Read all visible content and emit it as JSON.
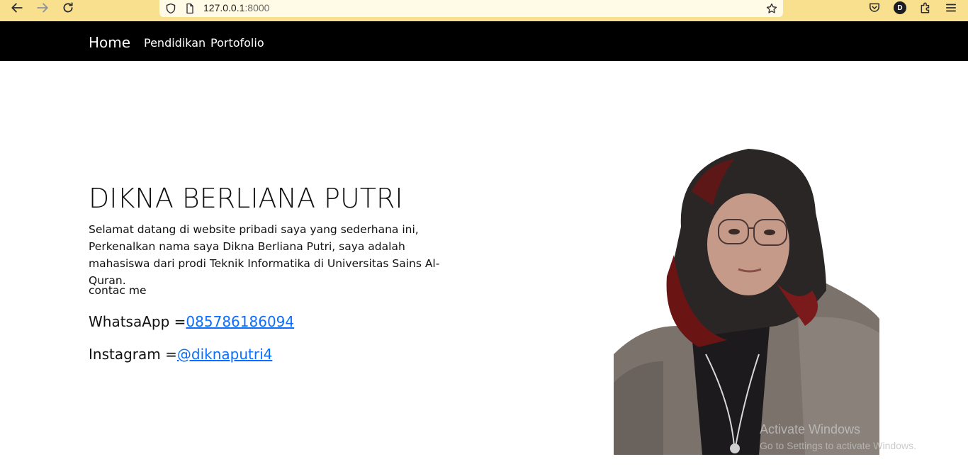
{
  "browser": {
    "url_host": "127.0.0.1",
    "url_port": ":8000",
    "profile_initial": "D",
    "icons": [
      "back-arrow-icon",
      "forward-arrow-icon",
      "reload-icon",
      "shield-icon",
      "page-icon",
      "star-icon",
      "pocket-icon",
      "extensions-icon",
      "menu-icon"
    ]
  },
  "nav": {
    "brand": "Home",
    "links": [
      "Pendidikan",
      "Portofolio"
    ]
  },
  "hero": {
    "title": "DIKNA BERLIANA PUTRI",
    "intro": "Selamat datang di website pribadi saya yang sederhana ini, Perkenalkan nama saya Dikna Berliana Putri, saya adalah mahasiswa dari prodi Teknik Informatika di Universitas Sains Al-Quran.",
    "contact_label": "contac me",
    "whatsapp_label": "WhatsaApp =",
    "whatsapp_value": "085786186094",
    "instagram_label": "Instagram =",
    "instagram_value": "@diknaputri4"
  },
  "watermark": {
    "line1": "Activate Windows",
    "line2": "Go to Settings to activate Windows."
  },
  "colors": {
    "toolbar": "#f9e08e",
    "navbar": "#000000",
    "link": "#0d6efd"
  }
}
